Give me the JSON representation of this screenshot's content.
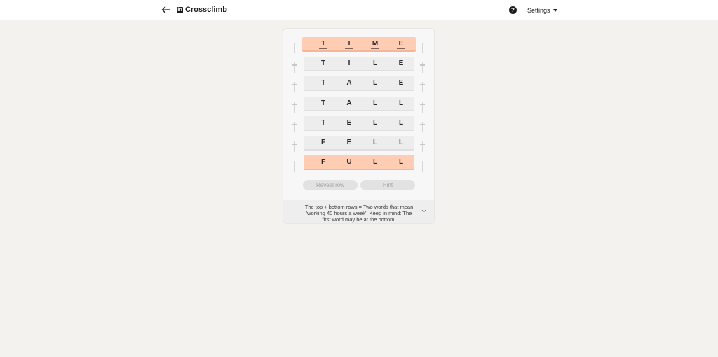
{
  "header": {
    "title": "Crossclimb",
    "logo_text": "in",
    "help_glyph": "?",
    "settings_label": "Settings"
  },
  "game": {
    "rows": [
      {
        "letters": [
          "T",
          "I",
          "M",
          "E"
        ],
        "fixed": true
      },
      {
        "letters": [
          "T",
          "I",
          "L",
          "E"
        ],
        "fixed": false
      },
      {
        "letters": [
          "T",
          "A",
          "L",
          "E"
        ],
        "fixed": false
      },
      {
        "letters": [
          "T",
          "A",
          "L",
          "L"
        ],
        "fixed": false
      },
      {
        "letters": [
          "T",
          "E",
          "L",
          "L"
        ],
        "fixed": false
      },
      {
        "letters": [
          "F",
          "E",
          "L",
          "L"
        ],
        "fixed": false
      },
      {
        "letters": [
          "F",
          "U",
          "L",
          "L"
        ],
        "fixed": true
      }
    ],
    "reveal_label": "Reveal row",
    "hint_label": "Hint",
    "clue": "The top + bottom rows = Two words that mean 'working 40 hours a week'. Keep in mind: The first word may be at the bottom."
  },
  "colors": {
    "fixed_row": "#ffcdb3",
    "row": "#ededed",
    "background": "#f4f2ee"
  },
  "icons": {
    "back": "arrow-left-icon",
    "help": "question-circle-icon",
    "settings_caret": "caret-down-icon",
    "clue_toggle": "chevron-down-icon"
  }
}
